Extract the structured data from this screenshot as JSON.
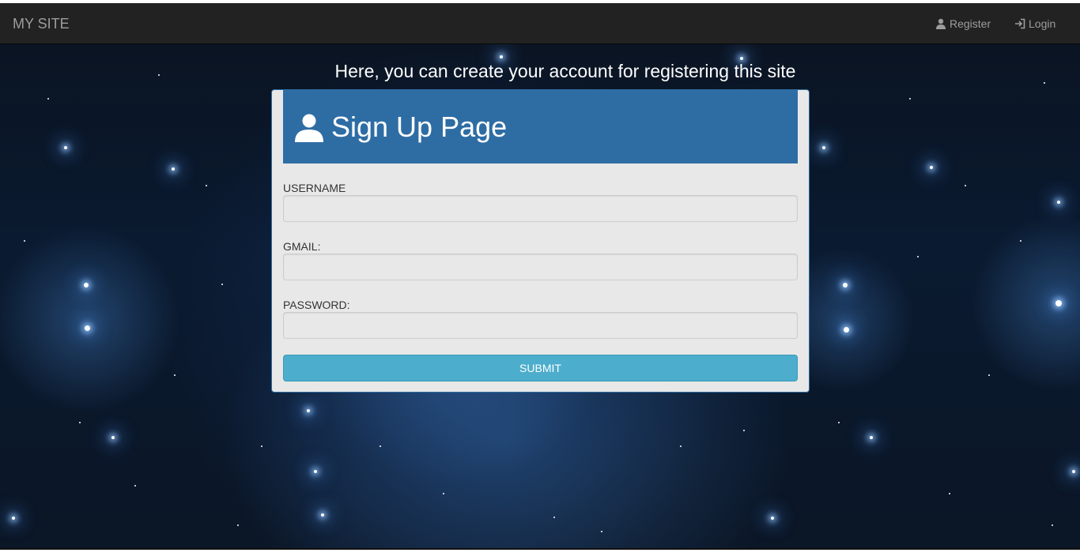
{
  "navbar": {
    "brand": "MY SITE",
    "register_label": "Register",
    "login_label": "Login"
  },
  "headline": "Here, you can create your account for registering this site",
  "signup": {
    "title": "Sign Up Page",
    "username_label": "USERNAME",
    "gmail_label": "GMAIL:",
    "password_label": "PASSWORD:",
    "username_value": "",
    "gmail_value": "",
    "password_value": "",
    "submit_label": "SUBMIT"
  },
  "colors": {
    "navbar_bg": "#222222",
    "card_header_bg": "#2e6da4",
    "submit_bg": "#4dadcc",
    "card_bg": "#e8e8e8"
  },
  "icons": {
    "register": "user-icon",
    "login": "login-icon",
    "title": "user-icon"
  }
}
